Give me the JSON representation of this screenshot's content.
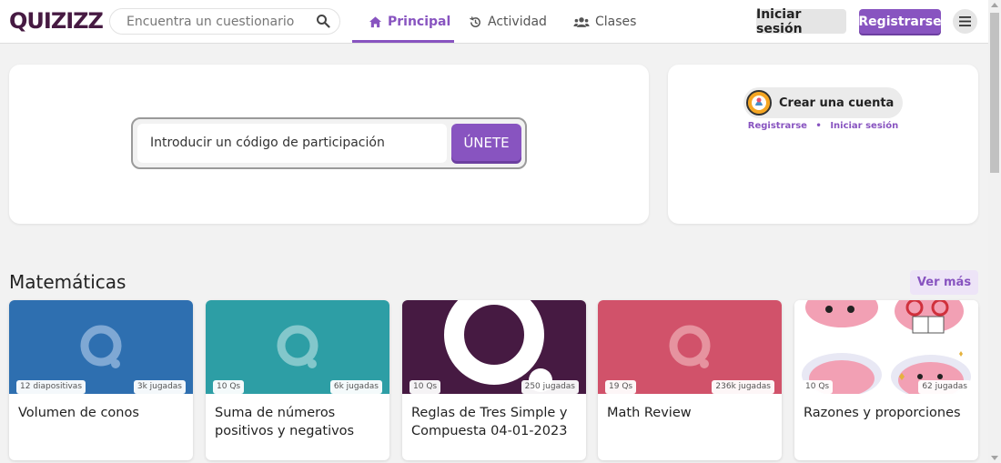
{
  "header": {
    "logo": "QUIZIZZ",
    "search_placeholder": "Encuentra un cuestionario",
    "nav": [
      {
        "label": "Principal",
        "icon": "home-icon",
        "active": true
      },
      {
        "label": "Actividad",
        "icon": "history-icon",
        "active": false
      },
      {
        "label": "Clases",
        "icon": "users-icon",
        "active": false
      }
    ],
    "login_label": "Iniciar sesión",
    "register_label": "Registrarse"
  },
  "join": {
    "placeholder": "Introducir un código de participación",
    "button_label": "ÚNETE"
  },
  "account": {
    "create_label": "Crear una cuenta",
    "register_link": "Registrarse",
    "separator": "•",
    "login_link": "Iniciar sesión"
  },
  "section": {
    "title": "Matemáticas",
    "see_more": "Ver más"
  },
  "quizzes": [
    {
      "title": "Volumen de conos",
      "left_badge": "12 diapositivas",
      "right_badge": "3k jugadas",
      "color": "#2e6fb0"
    },
    {
      "title": "Suma de números positivos y negativos",
      "left_badge": "10 Qs",
      "right_badge": "6k jugadas",
      "color": "#2d9ea5"
    },
    {
      "title": "Reglas de Tres Simple y Compuesta 04-01-2023",
      "left_badge": "10 Qs",
      "right_badge": "250 jugadas",
      "color": "#461a42"
    },
    {
      "title": "Math Review",
      "left_badge": "19 Qs",
      "right_badge": "236k jugadas",
      "color": "#d1526a"
    },
    {
      "title": "Razones y proporciones",
      "left_badge": "10 Qs",
      "right_badge": "62 jugadas",
      "color": "#ffffff"
    }
  ],
  "colors": {
    "brand": "#8854c0",
    "logo": "#461a42"
  }
}
